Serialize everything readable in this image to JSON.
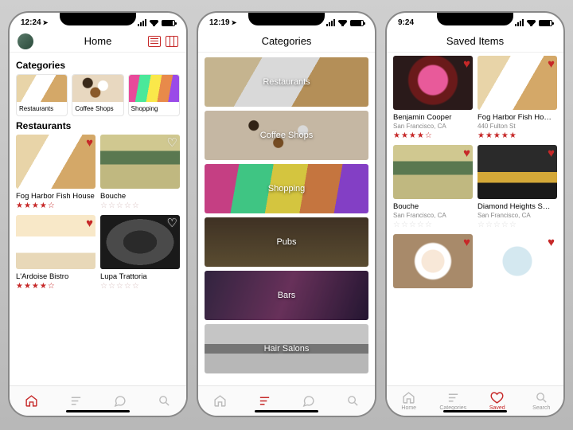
{
  "screens": {
    "home": {
      "time": "12:24",
      "title": "Home",
      "sec_categories": "Categories",
      "sec_restaurants": "Restaurants",
      "categories": [
        {
          "label": "Restaurants"
        },
        {
          "label": "Coffee Shops"
        },
        {
          "label": "Shopping"
        }
      ],
      "restaurants": [
        {
          "name": "Fog Harbor Fish House",
          "stars": "★★★★☆",
          "fav": true
        },
        {
          "name": "Bouche",
          "stars": "☆☆☆☆☆",
          "fav": false
        },
        {
          "name": "L'Ardoise Bistro",
          "stars": "★★★★☆",
          "fav": true
        },
        {
          "name": "Lupa Trattoria",
          "stars": "☆☆☆☆☆",
          "fav": false
        }
      ],
      "tabs": [
        "home",
        "categories",
        "chat",
        "search"
      ],
      "active_tab": 0
    },
    "categories": {
      "time": "12:19",
      "title": "Categories",
      "items": [
        "Restaurants",
        "Coffee Shops",
        "Shopping",
        "Pubs",
        "Bars",
        "Hair Salons"
      ],
      "active_tab": 1
    },
    "saved": {
      "time": "9:24",
      "title": "Saved Items",
      "items": [
        {
          "name": "Benjamin Cooper",
          "sub": "San Francisco, CA",
          "stars": "★★★★☆",
          "fav": true,
          "starClass": "f"
        },
        {
          "name": "Fog Harbor Fish Ho…",
          "sub": "440 Fulton St",
          "stars": "★★★★★",
          "fav": true,
          "starClass": "f"
        },
        {
          "name": "Bouche",
          "sub": "San Francisco, CA",
          "stars": "☆☆☆☆☆",
          "fav": true,
          "starClass": "ge"
        },
        {
          "name": "Diamond Heights S…",
          "sub": "San Francisco, CA",
          "stars": "☆☆☆☆☆",
          "fav": true,
          "starClass": "ge"
        }
      ],
      "tab_labels": [
        "Home",
        "Categories",
        "Saved",
        "Search"
      ],
      "active_tab": 2
    }
  },
  "icons": {
    "heart_filled": "♥",
    "heart_outline": "♡"
  }
}
